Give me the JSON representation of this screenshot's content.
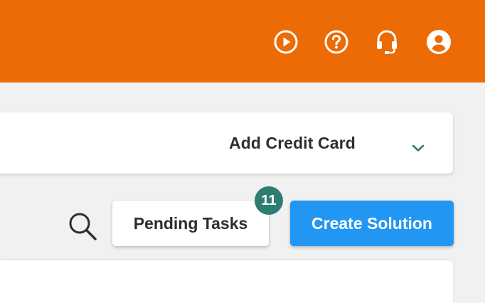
{
  "header": {
    "background": "#ec6b05",
    "icons": [
      {
        "name": "play-circle-icon"
      },
      {
        "name": "help-circle-icon"
      },
      {
        "name": "headset-icon"
      },
      {
        "name": "account-circle-icon"
      }
    ]
  },
  "credit_card": {
    "label": "Add Credit Card",
    "chevron": "chevron-down-icon",
    "chevron_color": "#2e7d74"
  },
  "toolbar": {
    "search_icon": "search-icon",
    "pending_tasks_label": "Pending Tasks",
    "pending_tasks_count": "11",
    "create_solution_label": "Create Solution"
  },
  "colors": {
    "accent": "#2196f3",
    "badge": "#2e7d74",
    "page_bg": "#f1f1f1"
  }
}
